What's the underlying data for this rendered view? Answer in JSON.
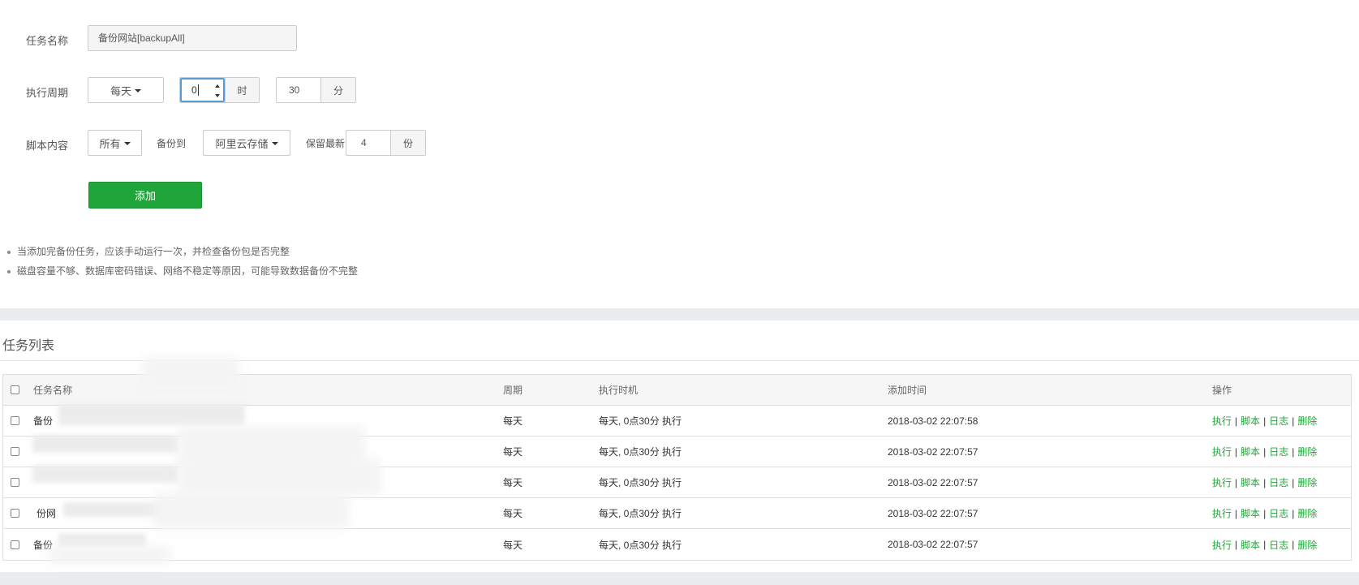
{
  "form": {
    "task_name": {
      "label": "任务名称",
      "value": "备份网站[backupAll]"
    },
    "cycle": {
      "label": "执行周期",
      "period_selected": "每天",
      "hour_value": "0",
      "hour_unit": "时",
      "minute_value": "30",
      "minute_unit": "分"
    },
    "script": {
      "label": "脚本内容",
      "content_selected": "所有",
      "backup_to_label": "备份到",
      "backup_to_selected": "阿里云存储",
      "keep_latest_label": "保留最新",
      "keep_value": "4",
      "keep_unit": "份"
    },
    "add_button": "添加"
  },
  "tips": [
    "当添加完备份任务，应该手动运行一次，并检查备份包是否完整",
    "磁盘容量不够、数据库密码错误、网络不稳定等原因，可能导致数据备份不完整"
  ],
  "task_list": {
    "title": "任务列表",
    "columns": [
      "任务名称",
      "周期",
      "执行时机",
      "添加时间",
      "操作"
    ],
    "rows": [
      {
        "name": "备份",
        "period": "每天",
        "timing": "每天, 0点30分 执行",
        "added": "2018-03-02 22:07:58"
      },
      {
        "name": "",
        "period": "每天",
        "timing": "每天, 0点30分 执行",
        "added": "2018-03-02 22:07:57"
      },
      {
        "name": "",
        "period": "每天",
        "timing": "每天, 0点30分 执行",
        "added": "2018-03-02 22:07:57"
      },
      {
        "name": "份网",
        "period": "每天",
        "timing": "每天, 0点30分 执行",
        "added": "2018-03-02 22:07:57"
      },
      {
        "name": "备份",
        "period": "每天",
        "timing": "每天, 0点30分 执行",
        "added": "2018-03-02 22:07:57"
      }
    ],
    "actions": {
      "run": "执行",
      "script": "脚本",
      "log": "日志",
      "delete": "删除",
      "separator": "|"
    }
  }
}
